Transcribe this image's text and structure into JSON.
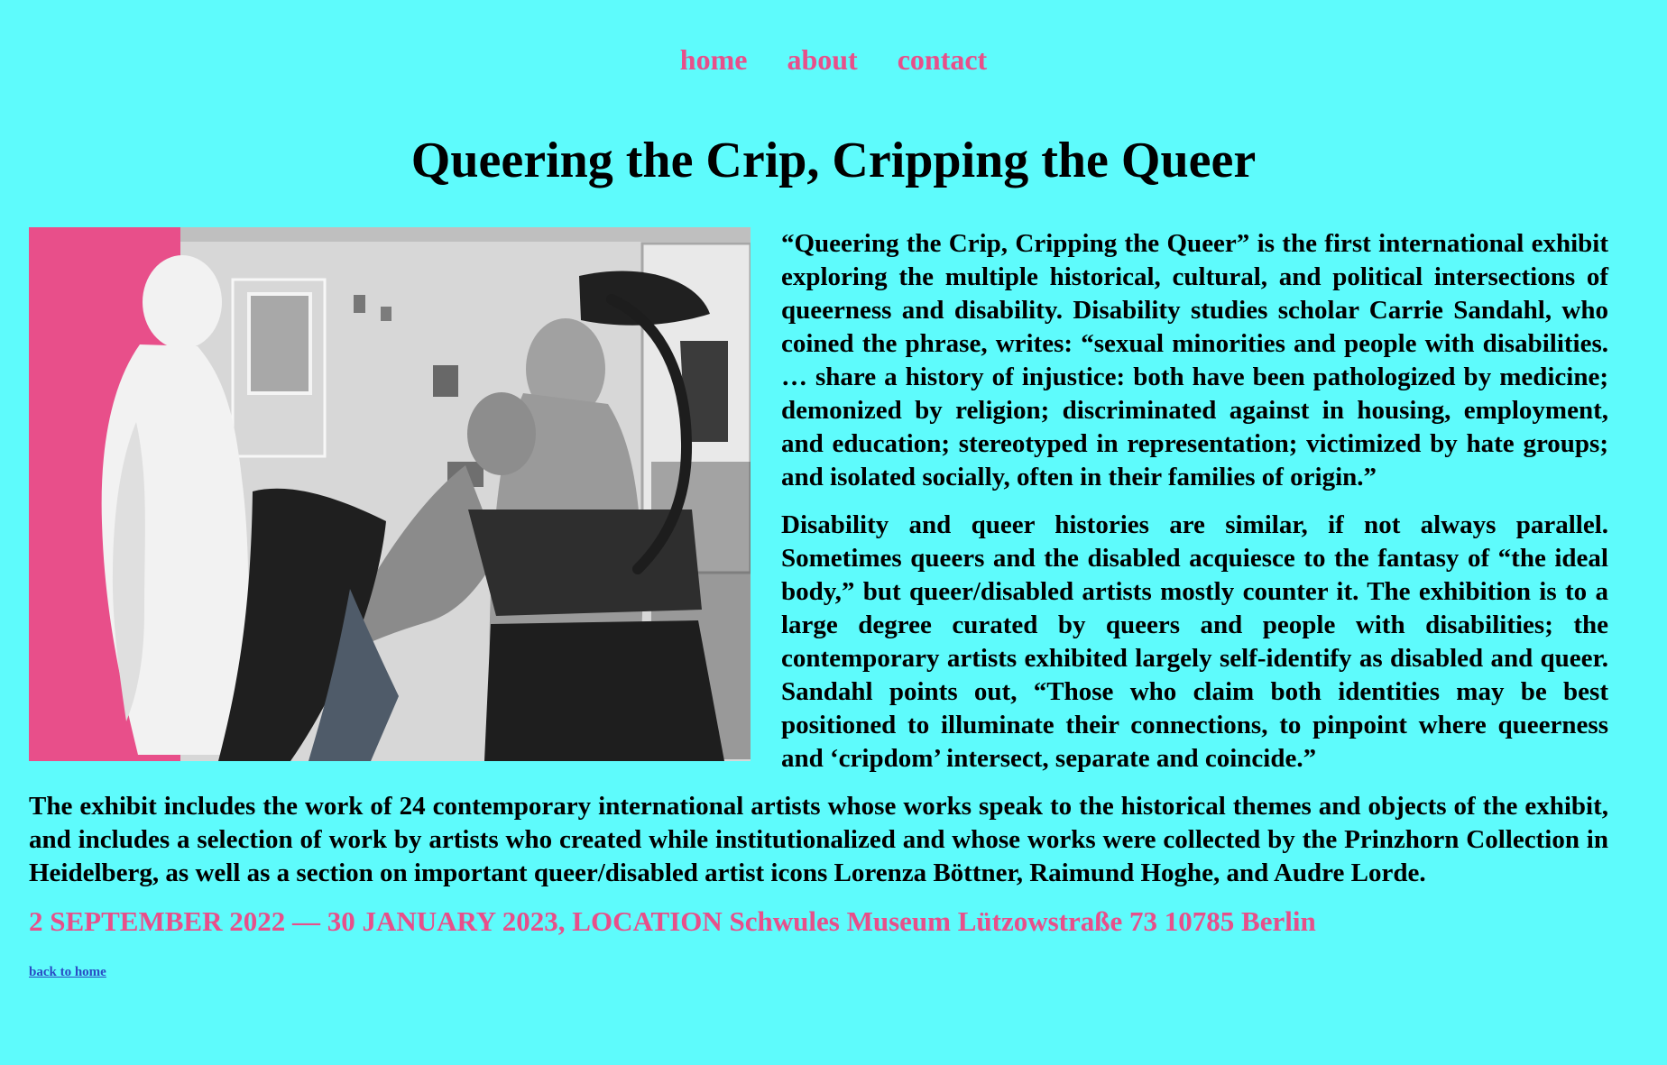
{
  "nav": {
    "items": [
      {
        "label": "home"
      },
      {
        "label": "about"
      },
      {
        "label": "contact"
      }
    ]
  },
  "page": {
    "title": "Queering the Crip, Cripping the Queer"
  },
  "hero_image": {
    "kind": "collage photo",
    "accent_color": "#e84f8a"
  },
  "article": {
    "paragraph_1": "“Queering the Crip, Cripping the Queer” is the first international exhibit exploring the multiple historical, cultural, and political intersections of queerness and disability. Disability studies scholar Carrie Sandahl, who coined the phrase, writes: “sexual minorities and people with disabilities. … share a history of injustice: both have been pathologized by medicine; demonized by religion; discriminated against in housing, employment, and education; stereotyped in representation; victimized by hate groups; and isolated socially, often in their families of origin.”",
    "paragraph_2": "Disability and queer histories are similar, if not always parallel. Sometimes queers and the disabled acquiesce to the fantasy of “the ideal body,” but queer/disabled artists mostly counter it. The exhibition is to a large degree curated by queers and people with disabilities; the contemporary artists exhibited largely self-identify as disabled and queer. Sandahl points out, “Those who claim both identities may be best positioned to illuminate their connections, to pinpoint where queerness and ‘cripdom’ intersect, separate and coincide.”",
    "paragraph_3": "The exhibit includes the work of 24 contemporary international artists whose works speak to the historical themes and objects of the exhibit, and includes a selection of work by artists who created while institutionalized and whose works were collected by the Prinzhorn Collection in Heidelberg, as well as a section on important queer/disabled artist icons Lorenza Böttner, Raimund Hoghe, and Audre Lorde.",
    "date_location": "2 SEPTEMBER 2022 — 30 JANUARY 2023, LOCATION Schwules Museum Lützowstraße 73 10785 Berlin"
  },
  "footer": {
    "back_link": "back to home"
  },
  "colors": {
    "background": "#5efbfc",
    "accent": "#e84f8a",
    "text": "#000000",
    "link": "#2a4bc4"
  }
}
